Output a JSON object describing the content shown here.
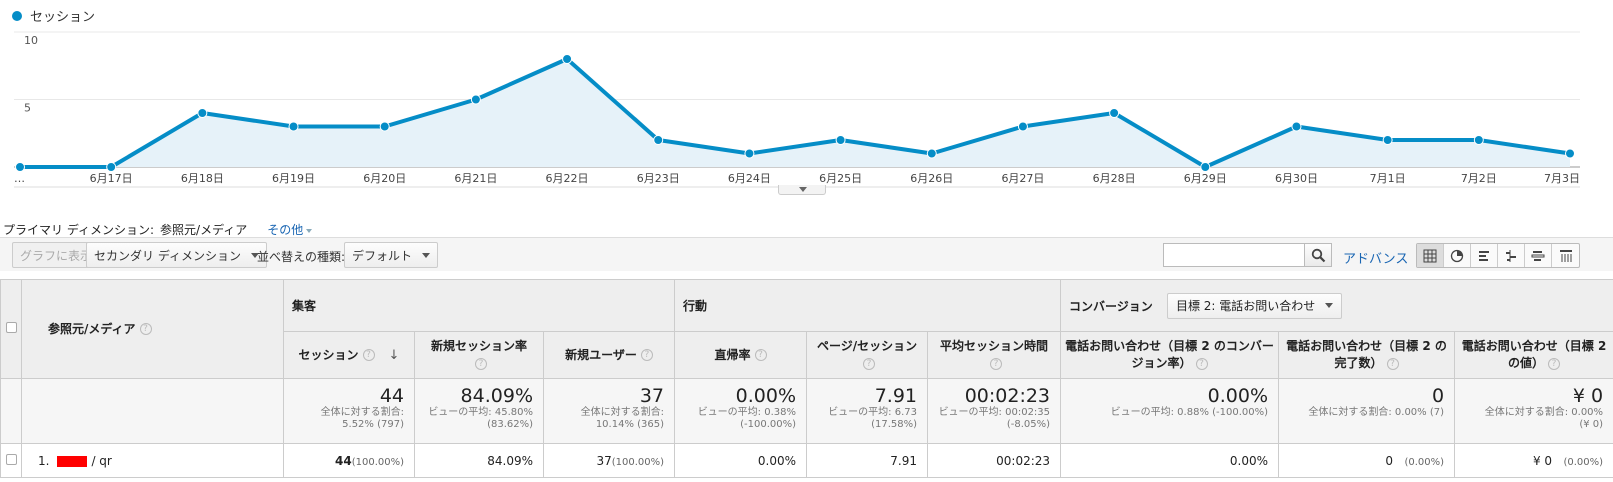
{
  "chart": {
    "legend": "セッション",
    "color": "#058dc7",
    "y_ticks": [
      "10",
      "5"
    ],
    "x_labels": [
      "…",
      "6月17日",
      "6月18日",
      "6月19日",
      "6月20日",
      "6月21日",
      "6月22日",
      "6月23日",
      "6月24日",
      "6月25日",
      "6月26日",
      "6月27日",
      "6月28日",
      "6月29日",
      "6月30日",
      "7月1日",
      "7月2日",
      "7月3日"
    ],
    "values": [
      0,
      0,
      4,
      3,
      3,
      5,
      8,
      2,
      1,
      2,
      1,
      3,
      4,
      0,
      3,
      2,
      2,
      1
    ]
  },
  "primary_dimension": {
    "label": "プライマリ ディメンション:",
    "active": "参照元/メディア",
    "other": "その他"
  },
  "toolbar": {
    "chart_button": "グラフに表示",
    "secondary_dimension": "セカンダリ ディメンション",
    "sort_label": "並べ替えの種類:",
    "sort_value": "デフォルト",
    "advanced": "アドバンス"
  },
  "table": {
    "dim_header": "参照元/メディア",
    "groups": {
      "acquisition": "集客",
      "behavior": "行動",
      "conversion": "コンバージョン",
      "goal_select": "目標 2: 電話お問い合わせ"
    },
    "columns": {
      "sessions": "セッション",
      "new_session_rate": "新規セッション率",
      "new_users": "新規ユーザー",
      "bounce_rate": "直帰率",
      "pages_per_session": "ページ/セッション",
      "avg_duration": "平均セッション時間",
      "goal_cvr": "電話お問い合わせ（目標 2 のコンバージョン率）",
      "goal_completions": "電話お問い合わせ（目標 2 の完了数）",
      "goal_value": "電話お問い合わせ（目標 2 の値）"
    },
    "totals": {
      "sessions": "44",
      "sessions_sub1": "全体に対する割合:",
      "sessions_sub2": "5.52% (797)",
      "new_session_rate": "84.09%",
      "new_session_rate_sub1": "ビューの平均: 45.80%",
      "new_session_rate_sub2": "(83.62%)",
      "new_users": "37",
      "new_users_sub1": "全体に対する割合:",
      "new_users_sub2": "10.14% (365)",
      "bounce_rate": "0.00%",
      "bounce_rate_sub1": "ビューの平均: 0.38%",
      "bounce_rate_sub2": "(-100.00%)",
      "pages_per_session": "7.91",
      "pages_per_session_sub1": "ビューの平均: 6.73",
      "pages_per_session_sub2": "(17.58%)",
      "avg_duration": "00:02:23",
      "avg_duration_sub1": "ビューの平均: 00:02:35",
      "avg_duration_sub2": "(-8.05%)",
      "goal_cvr": "0.00%",
      "goal_cvr_sub1": "ビューの平均: 0.88% (-100.00%)",
      "goal_completions": "0",
      "goal_completions_sub1": "全体に対する割合: 0.00% (7)",
      "goal_value": "¥ 0",
      "goal_value_sub1": "全体に対する割合: 0.00%",
      "goal_value_sub2": "(¥ 0)"
    },
    "rows": [
      {
        "index": "1.",
        "dimension": "/ qr",
        "sessions": "44",
        "sessions_pct": "(100.00%)",
        "new_session_rate": "84.09%",
        "new_users": "37",
        "new_users_pct": "(100.00%)",
        "bounce_rate": "0.00%",
        "pages_per_session": "7.91",
        "avg_duration": "00:02:23",
        "goal_cvr": "0.00%",
        "goal_completions": "0",
        "goal_completions_pct": "(0.00%)",
        "goal_value": "¥ 0",
        "goal_value_pct": "(0.00%)"
      }
    ]
  }
}
